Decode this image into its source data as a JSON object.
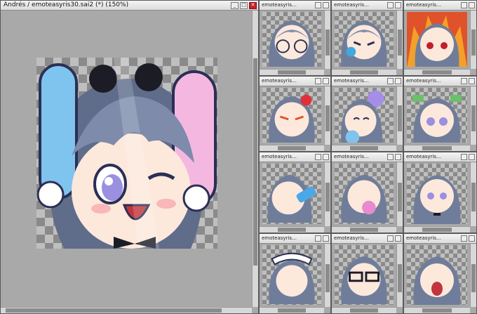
{
  "main_window": {
    "title": "Andrés / emoteasyris30.sai2 (*) (150%)",
    "controls": {
      "minimize": "_",
      "maximize": "□",
      "close": "✕"
    }
  },
  "thumb_windows": [
    {
      "title": "emoteasyris…"
    },
    {
      "title": "emoteasyris…"
    },
    {
      "title": "emoteasyris…"
    },
    {
      "title": "emoteasyris…"
    },
    {
      "title": "emoteasyris…"
    },
    {
      "title": "emoteasyris…"
    },
    {
      "title": "emoteasyris…"
    },
    {
      "title": "emoteasyris…"
    },
    {
      "title": "emoteasyris…"
    },
    {
      "title": "emoteasyris…"
    },
    {
      "title": "emoteasyris…"
    },
    {
      "title": "emoteasyris…"
    }
  ],
  "colors": {
    "hair": "#6f7d9a",
    "bunny_ear_left": "#7fc4ee",
    "bunny_ear_right": "#f4b8e0",
    "fire": "#e0532a",
    "close_button": "#c4202c"
  },
  "icons": [
    "minimize-icon",
    "maximize-icon",
    "close-icon"
  ]
}
